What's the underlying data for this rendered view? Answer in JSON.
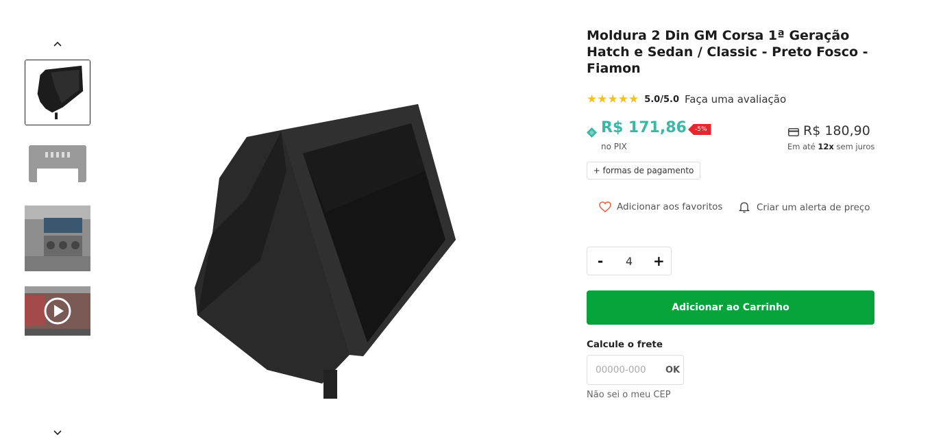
{
  "product": {
    "title": "Moldura 2 Din GM Corsa 1ª Geração Hatch e Sedan / Classic - Preto Fosco - Fiamon",
    "rating_stars": "★★★★★",
    "rating_score": "5.0/5.0",
    "rating_value": 5.0,
    "review_link": "Faça uma avaliação"
  },
  "pricing": {
    "pix_price": "R$ 171,86",
    "pix_label": "no PIX",
    "discount": "-5%",
    "card_price": "R$ 180,90",
    "installments_prefix": "Em até",
    "installments_count": "12x",
    "installments_suffix": "sem juros",
    "payment_methods_button": "+ formas de pagamento"
  },
  "actions": {
    "favorite_label": "Adicionar aos favoritos",
    "price_alert_label": "Criar um alerta de preço",
    "qty_minus": "-",
    "qty_value": "4",
    "qty_plus": "+",
    "add_to_cart": "Adicionar ao Carrinho"
  },
  "freight": {
    "label": "Calcule o frete",
    "placeholder": "00000-000",
    "ok": "OK",
    "unknown_cep": "Não sei o meu CEP"
  },
  "gallery": {
    "icons": [
      "chevron-up-icon",
      "chevron-down-icon",
      "play-icon",
      "heart-icon",
      "bell-icon",
      "card-icon",
      "pix-icon"
    ]
  },
  "colors": {
    "pix_price": "#3bb7a4",
    "discount_badge": "#e5262c",
    "cart_button": "#06a33a",
    "stars": "#f2c21b",
    "heart": "#e0603a"
  }
}
